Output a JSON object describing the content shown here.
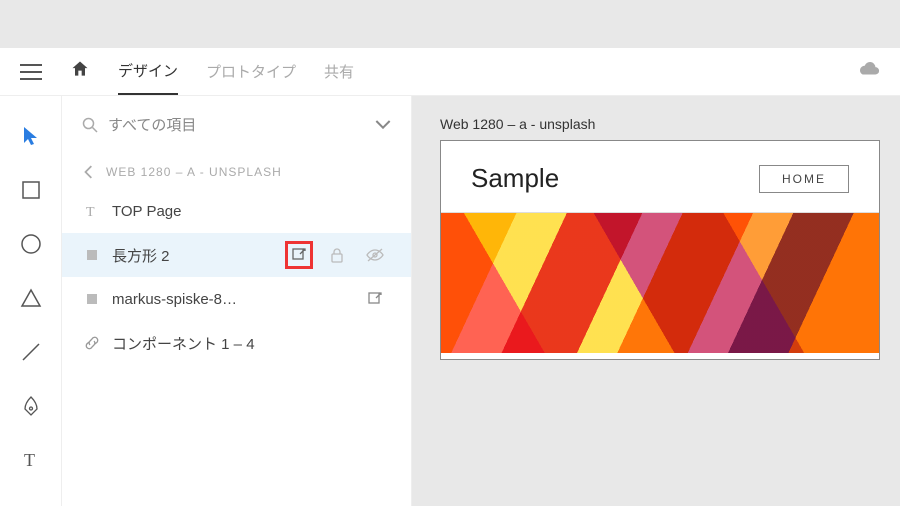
{
  "menubar": {
    "tabs": [
      {
        "label": "デザイン",
        "active": true
      },
      {
        "label": "プロトタイプ",
        "active": false
      },
      {
        "label": "共有",
        "active": false
      }
    ]
  },
  "panel": {
    "search_text": "すべての項目",
    "breadcrumb": "WEB 1280 – A - UNSPLASH",
    "layers": [
      {
        "name": "TOP Page",
        "icon": "text",
        "selected": false,
        "export": false,
        "lock": false,
        "hide": false
      },
      {
        "name": "長方形 2",
        "icon": "square",
        "selected": true,
        "export": true,
        "lock": true,
        "hide": true,
        "highlight_export": true
      },
      {
        "name": "markus-spiske-8…",
        "icon": "square",
        "selected": false,
        "export": true,
        "lock": false,
        "hide": false
      },
      {
        "name": "コンポーネント 1 – 4",
        "icon": "link",
        "selected": false,
        "export": false,
        "lock": false,
        "hide": false
      }
    ]
  },
  "canvas": {
    "artboard_label": "Web 1280 – a - unsplash",
    "artboard": {
      "title": "Sample",
      "nav_button": "HOME"
    }
  }
}
